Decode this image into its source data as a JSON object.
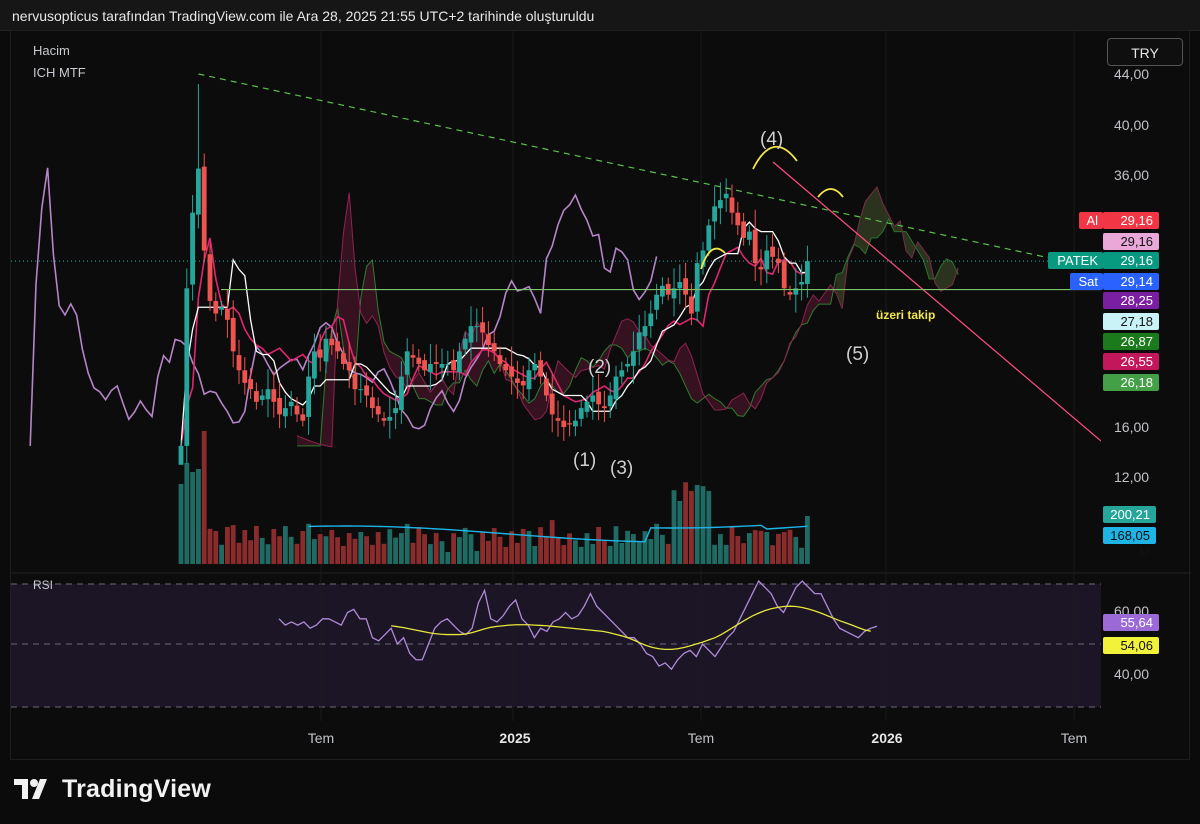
{
  "header": {
    "title": "nervusopticus tarafından TradingView.com ile Ara 28, 2025 21:55 UTC+2 tarihinde oluşturuldu"
  },
  "legend": {
    "volume": "Hacim",
    "indicator": "ICH MTF",
    "rsi": "RSI"
  },
  "currency": "TRY",
  "brand": {
    "name": "TradingView"
  },
  "colors": {
    "up": "#26a69a",
    "down": "#ef5350",
    "lagging": "#b585c8",
    "tenkan": "#ffffff",
    "kijun": "#e0266e",
    "trend_down": "#ff4d7d",
    "support": "#7bc46a",
    "rsi": "#b08bd8",
    "rsi_ma": "#e7e63a"
  },
  "price_axis": {
    "ticks": [
      "44,00",
      "40,00",
      "36,00",
      "16,00",
      "12,00"
    ]
  },
  "rsi_axis": {
    "ticks": [
      "60,00",
      "40,00"
    ]
  },
  "time_axis": {
    "labels": [
      "Tem",
      "2025",
      "Tem",
      "2026",
      "Tem"
    ]
  },
  "price_tags": [
    {
      "value": "29,16",
      "label": "Al",
      "bg": "#f23645",
      "fg": "#ffffff"
    },
    {
      "value": "29,16",
      "label": "",
      "bg": "#e9a8d8",
      "fg": "#111111"
    },
    {
      "value": "29,16",
      "label": "PATEK",
      "bg": "#089981",
      "fg": "#ffffff"
    },
    {
      "value": "29,14",
      "label": "Sat",
      "bg": "#2962ff",
      "fg": "#ffffff"
    },
    {
      "value": "28,25",
      "label": "",
      "bg": "#7b1fa2",
      "fg": "#ffffff"
    },
    {
      "value": "27,18",
      "label": "",
      "bg": "#c9f3f6",
      "fg": "#111111"
    },
    {
      "value": "26,87",
      "label": "",
      "bg": "#1b7a1b",
      "fg": "#ffffff"
    },
    {
      "value": "26,55",
      "label": "",
      "bg": "#c2185b",
      "fg": "#ffffff"
    },
    {
      "value": "26,18",
      "label": "",
      "bg": "#43a047",
      "fg": "#ffffff"
    }
  ],
  "volume_tags": [
    {
      "value": "200,21 M",
      "bg": "#26a69a",
      "fg": "#ffffff"
    },
    {
      "value": "168,05 M",
      "bg": "#1eb4e6",
      "fg": "#111111"
    }
  ],
  "rsi_tags": [
    {
      "value": "55,64",
      "bg": "#9c6ad6",
      "fg": "#ffffff"
    },
    {
      "value": "54,06",
      "bg": "#f3f23a",
      "fg": "#111111"
    }
  ],
  "annotations": {
    "wave1": "(1)",
    "wave2": "(2)",
    "wave3": "(3)",
    "wave4": "(4)",
    "wave5": "(5)",
    "note": "üzeri takip"
  },
  "chart_data": {
    "type": "candlestick",
    "x_unit": "weeks",
    "time_labels": [
      "Tem",
      "2025",
      "Tem",
      "2026",
      "Tem"
    ],
    "y_unit": "TRY",
    "ylim": [
      12,
      44
    ],
    "close": [
      14.5,
      27,
      33,
      36.5,
      30,
      26,
      25,
      25.5,
      24.5,
      22,
      20.5,
      19.5,
      19,
      18,
      18.5,
      19,
      18,
      17,
      17.5,
      18,
      17,
      16.5,
      20,
      22,
      21.5,
      23,
      22.5,
      22,
      21,
      20.5,
      19,
      19,
      18.5,
      17.5,
      17,
      16.5,
      16.8,
      17.5,
      20,
      22,
      21.5,
      21,
      20.5,
      21,
      21,
      21,
      21,
      20.5,
      22,
      23,
      24,
      24,
      23.5,
      22.5,
      22,
      21,
      20.5,
      20,
      19.5,
      19.3,
      20.5,
      21,
      20,
      18.5,
      17,
      16.5,
      16,
      16.2,
      16.5,
      17.5,
      18,
      18.5,
      17.8,
      17.5,
      18.5,
      20,
      20.5,
      21,
      22,
      23.5,
      24,
      25,
      26.5,
      27.2,
      26.5,
      27,
      27.5,
      26.5,
      25,
      29,
      30,
      32,
      33.5,
      34,
      34.5,
      33,
      32,
      31,
      31.5,
      29,
      28.5,
      30,
      29.5,
      29,
      27,
      26.5,
      27,
      27.5,
      29.16
    ],
    "trendline_dashed": [
      [
        3,
        44
      ],
      [
        123,
        29.16
      ]
    ],
    "trendline_down": [
      [
        92,
        37
      ],
      [
        123,
        15
      ]
    ],
    "support_line": 26.9,
    "rsi": {
      "ylim": [
        30,
        75
      ],
      "ticks": [
        60,
        40
      ],
      "rsi_values": [
        58,
        56,
        57,
        56,
        57,
        55,
        56,
        58,
        58,
        57,
        56,
        60,
        61,
        58,
        58,
        52,
        51,
        53,
        55,
        50,
        52,
        47,
        45,
        45,
        50,
        55,
        57,
        58,
        56,
        54,
        53,
        55,
        63,
        67,
        58,
        57,
        59,
        62,
        64,
        58,
        56,
        52,
        55,
        54,
        57,
        58,
        60,
        58,
        59,
        62,
        66,
        62,
        60,
        58,
        56,
        54,
        52,
        52,
        50,
        47,
        46,
        43,
        44,
        42,
        45,
        47,
        48,
        46,
        50,
        48,
        46,
        49,
        52,
        54,
        58,
        62,
        66,
        70,
        68,
        66,
        62,
        60,
        64,
        68,
        70,
        68,
        66,
        66,
        62,
        58,
        55,
        54,
        53,
        52,
        54,
        55,
        55.64
      ],
      "rsi_ma_values": [
        56,
        56,
        56,
        56,
        56,
        55.5,
        55.5,
        55.5,
        55.5,
        55.5,
        55.6,
        56,
        56.3,
        56.5,
        56.6,
        56.5,
        56.3,
        56.1,
        55.8,
        55.5,
        55.2,
        54.8,
        54.4,
        54,
        53.6,
        53.3,
        53.1,
        53,
        53,
        53,
        53.2,
        53.6,
        54.2,
        54.8,
        55.3,
        55.6,
        55.8,
        56,
        56.1,
        56.1,
        56.1,
        56,
        55.9,
        55.8,
        55.6,
        55.4,
        55.2,
        55,
        54.8,
        54.6,
        54.4,
        54.2,
        54,
        53.6,
        53.1,
        52.6,
        52,
        51.2,
        50.3,
        49.5,
        48.9,
        48.5,
        48.3,
        48.3,
        48.5,
        48.9,
        49.4,
        50,
        50.6,
        51.3,
        52,
        53,
        54.2,
        55.4,
        56.6,
        57.8,
        58.9,
        59.8,
        60.6,
        61.2,
        61.6,
        61.9,
        62,
        61.9,
        61.6,
        61.1,
        60.5,
        59.8,
        59,
        58.2,
        57.4,
        56.7,
        56,
        55.2,
        54.5,
        54.06
      ]
    },
    "volume_unit": "M",
    "last_volume": "200,21 M",
    "volume_ma_last": "168,05 M"
  }
}
